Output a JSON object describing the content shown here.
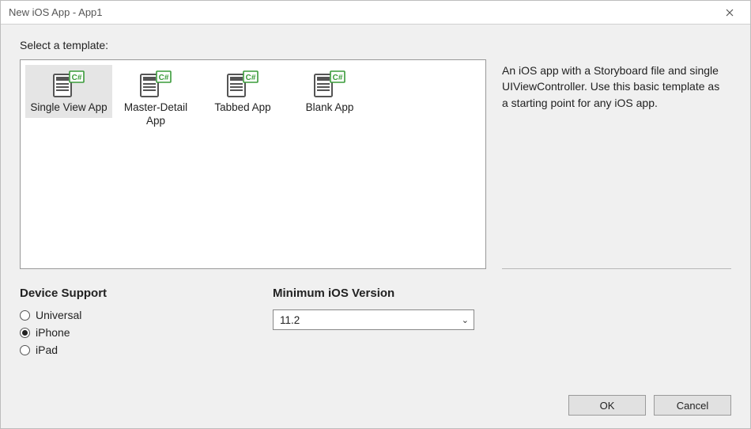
{
  "window": {
    "title": "New iOS App - App1"
  },
  "prompt": "Select a template:",
  "templates": [
    {
      "label": "Single View App",
      "selected": true
    },
    {
      "label": "Master-Detail App",
      "selected": false
    },
    {
      "label": "Tabbed App",
      "selected": false
    },
    {
      "label": "Blank App",
      "selected": false
    }
  ],
  "description": "An iOS app with a Storyboard file and single UIViewController. Use this basic template as a starting point for any iOS app.",
  "device_support": {
    "heading": "Device Support",
    "options": [
      {
        "label": "Universal",
        "selected": false
      },
      {
        "label": "iPhone",
        "selected": true
      },
      {
        "label": "iPad",
        "selected": false
      }
    ]
  },
  "min_ios": {
    "heading": "Minimum iOS Version",
    "value": "11.2"
  },
  "buttons": {
    "ok": "OK",
    "cancel": "Cancel"
  }
}
